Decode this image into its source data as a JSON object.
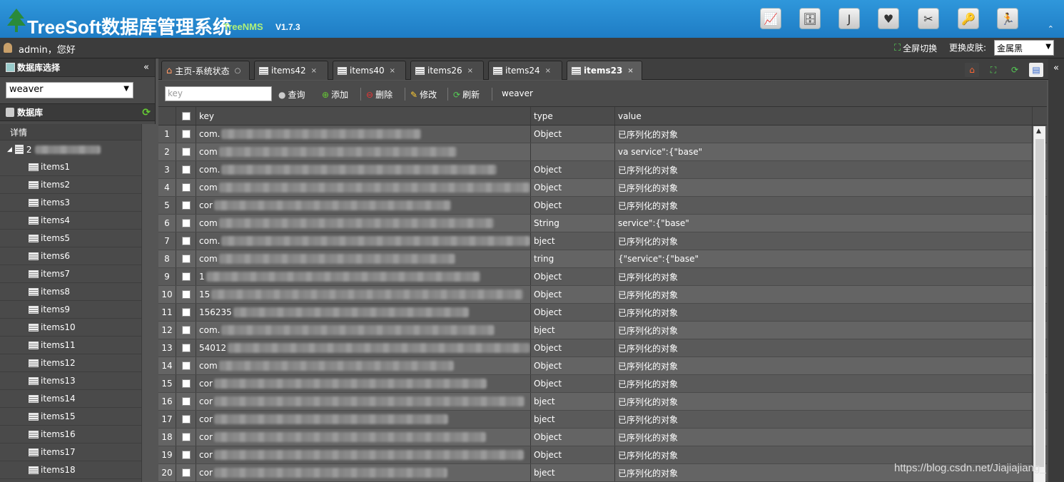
{
  "header": {
    "title": "TreeSoft数据库管理系统",
    "subtitle": "TreeNMS",
    "version": "V1.7.3",
    "buttons": [
      {
        "name": "chart-icon",
        "glyph": "📈"
      },
      {
        "name": "database-icon",
        "glyph": "🗄"
      },
      {
        "name": "j-icon",
        "glyph": "J"
      },
      {
        "name": "heart-icon",
        "glyph": "♥"
      },
      {
        "name": "tools-icon",
        "glyph": "✂"
      },
      {
        "name": "key-icon",
        "glyph": "🔑"
      },
      {
        "name": "user-run-icon",
        "glyph": "🏃"
      }
    ],
    "collapse": "⌃"
  },
  "userbar": {
    "user": "admin，您好",
    "fullscreen": "全屏切换",
    "skin_label": "更换皮肤:",
    "skin_value": "金属黑"
  },
  "sidebar": {
    "db_select_title": "数据库选择",
    "db_selected": "weaver",
    "db_title": "数据库",
    "detail": "详情",
    "root_prefix": "2",
    "items": [
      "items1",
      "items2",
      "items3",
      "items4",
      "items5",
      "items6",
      "items7",
      "items8",
      "items9",
      "items10",
      "items11",
      "items12",
      "items13",
      "items14",
      "items15",
      "items16",
      "items17",
      "items18"
    ]
  },
  "tabs": [
    {
      "label": "主页-系统状态",
      "home": true
    },
    {
      "label": "items42"
    },
    {
      "label": "items40"
    },
    {
      "label": "items26"
    },
    {
      "label": "items24"
    },
    {
      "label": "items23",
      "active": true
    }
  ],
  "toolbar": {
    "key_placeholder": "key",
    "query": "查询",
    "add": "添加",
    "delete": "删除",
    "edit": "修改",
    "refresh": "刷新",
    "db_name": "weaver"
  },
  "grid": {
    "columns": {
      "key": "key",
      "type": "type",
      "value": "value"
    },
    "rows": [
      {
        "n": "1",
        "key": "com.",
        "type": "Object",
        "value": "已序列化的对象"
      },
      {
        "n": "2",
        "key": "com",
        "type": "",
        "value": "va              service\":{\"base\""
      },
      {
        "n": "3",
        "key": "com.",
        "type": "Object",
        "value": "已序列化的对象"
      },
      {
        "n": "4",
        "key": "com",
        "type": "Object",
        "value": "已序列化的对象"
      },
      {
        "n": "5",
        "key": "cor",
        "type": "Object",
        "value": "已序列化的对象"
      },
      {
        "n": "6",
        "key": "com",
        "type": "String",
        "value": "                service\":{\"base\""
      },
      {
        "n": "7",
        "key": "com.",
        "type": "bject",
        "value": "已序列化的对象"
      },
      {
        "n": "8",
        "key": "com",
        "type": "tring",
        "value": "                {\"service\":{\"base\""
      },
      {
        "n": "9",
        "key": "1",
        "type": "Object",
        "value": "已序列化的对象"
      },
      {
        "n": "10",
        "key": "15",
        "type": "Object",
        "value": "已序列化的对象"
      },
      {
        "n": "11",
        "key": "156235",
        "type": "Object",
        "value": "已序列化的对象"
      },
      {
        "n": "12",
        "key": "com.",
        "type": "bject",
        "value": "已序列化的对象"
      },
      {
        "n": "13",
        "key": "54012",
        "type": "Object",
        "value": "已序列化的对象"
      },
      {
        "n": "14",
        "key": "com",
        "type": "Object",
        "value": "已序列化的对象"
      },
      {
        "n": "15",
        "key": "cor",
        "type": "Object",
        "value": "已序列化的对象"
      },
      {
        "n": "16",
        "key": "cor",
        "type": "bject",
        "value": "已序列化的对象"
      },
      {
        "n": "17",
        "key": "cor",
        "type": "bject",
        "value": "已序列化的对象"
      },
      {
        "n": "18",
        "key": "cor",
        "type": "Object",
        "value": "已序列化的对象"
      },
      {
        "n": "19",
        "key": "cor",
        "type": "Object",
        "value": "已序列化的对象"
      },
      {
        "n": "20",
        "key": "cor",
        "type": "bject",
        "value": "已序列化的对象"
      }
    ]
  },
  "watermark": "https://blog.csdn.net/Jiajiajiang_"
}
